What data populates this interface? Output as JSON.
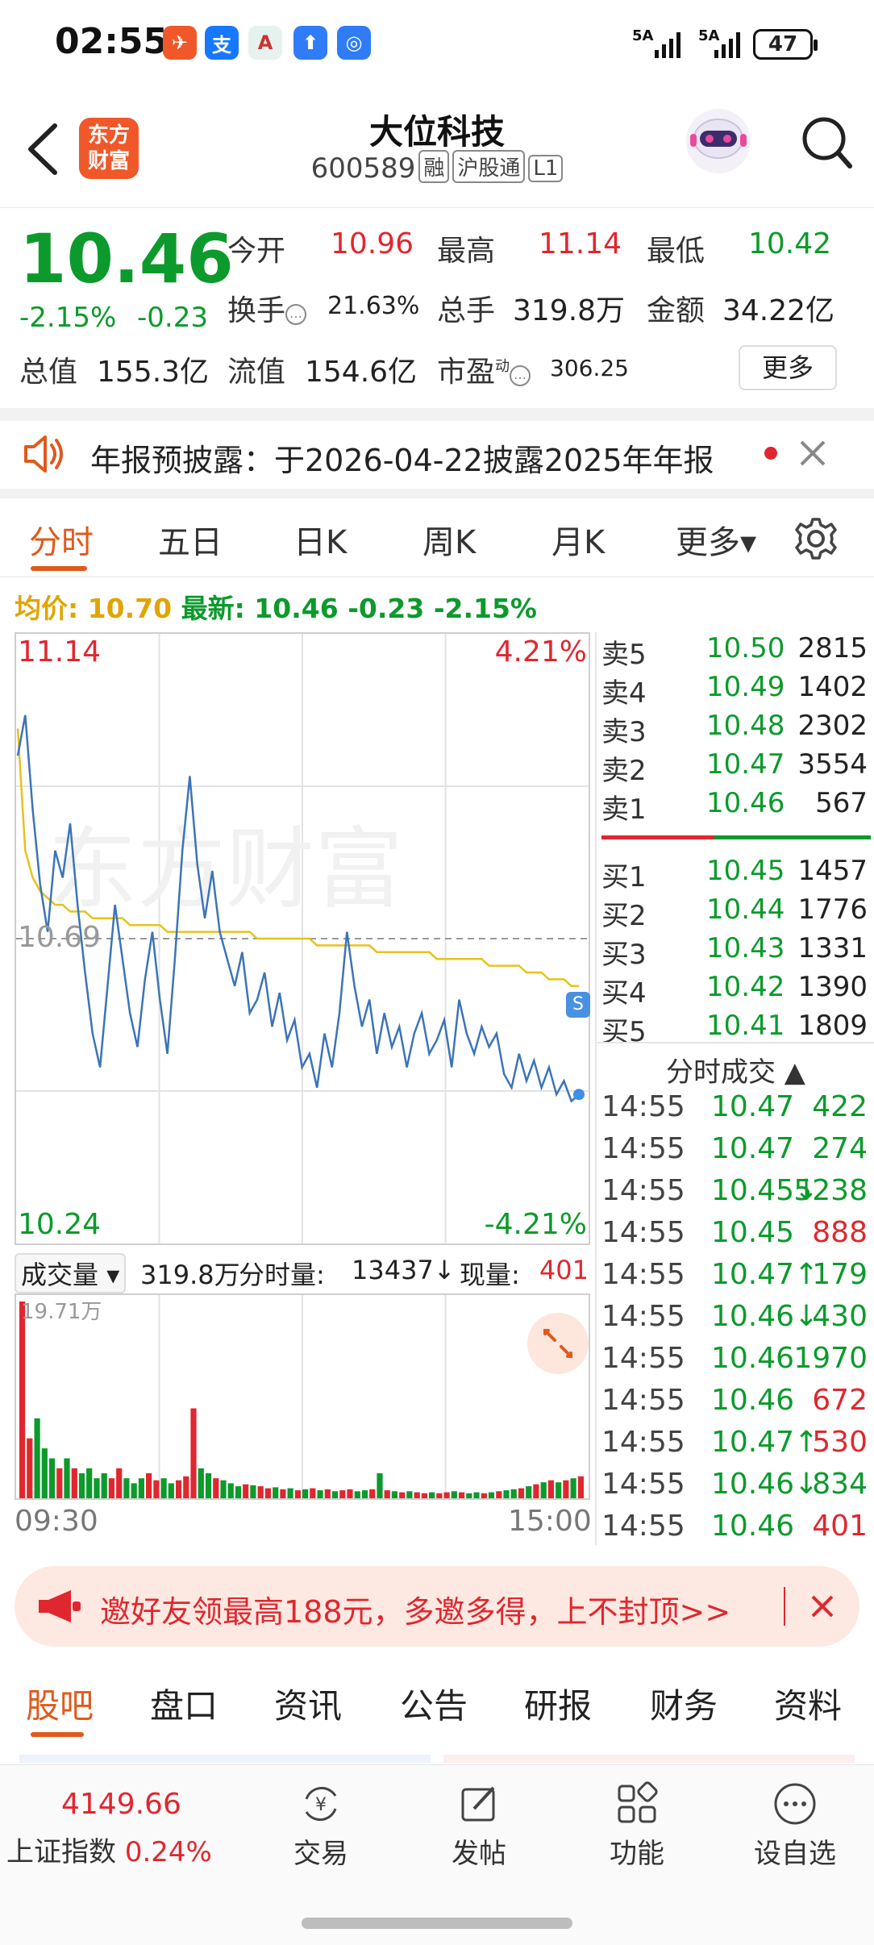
{
  "status": {
    "time": "02:55",
    "apps": [
      {
        "icon": "paper-plane-icon",
        "glyph": "✈",
        "color": "#f0582a"
      },
      {
        "icon": "alipay-icon",
        "glyph": "支",
        "color": "#1677ff"
      },
      {
        "icon": "bank-icon",
        "glyph": "A",
        "color": "#e6f2ee"
      },
      {
        "icon": "upload-icon",
        "glyph": "⬆",
        "color": "#2f7cf6"
      },
      {
        "icon": "chart-app-icon",
        "glyph": "◎",
        "color": "#2f7cf6"
      }
    ],
    "signal1": "5A",
    "signal2": "5A",
    "battery": "47"
  },
  "header": {
    "logo_line1": "东方",
    "logo_line2": "财富",
    "stock_name": "大位科技",
    "stock_code": "600589",
    "tag_margin": "融",
    "tag_connect": "沪股通",
    "tag_level": "L1"
  },
  "quote": {
    "price": "10.46",
    "change_pct": "-2.15%",
    "change_amt": "-0.23",
    "open_label": "今开",
    "open": "10.96",
    "high_label": "最高",
    "high": "11.14",
    "low_label": "最低",
    "low": "10.42",
    "turnover_label": "换手",
    "turnover": "21.63%",
    "volume_label": "总手",
    "volume": "319.8万",
    "amount_label": "金额",
    "amount": "34.22亿",
    "mcap_label": "总值",
    "mcap": "155.3亿",
    "float_label": "流值",
    "float": "154.6亿",
    "pe_label": "市盈",
    "pe_sup": "动",
    "pe": "306.25",
    "more": "更多"
  },
  "notice": {
    "text": "年报预披露：于2026-04-22披露2025年年报"
  },
  "chart_tabs": [
    "分时",
    "五日",
    "日K",
    "周K",
    "月K",
    "更多▾"
  ],
  "avg_line": {
    "avg_label": "均价:",
    "avg": "10.70",
    "latest_label": "最新:",
    "latest": "10.46",
    "chg": "-0.23",
    "pct": "-2.15%"
  },
  "chart_data": {
    "type": "line",
    "title": "",
    "ylim": [
      10.24,
      11.14
    ],
    "top_label": "11.14",
    "top_pct": "4.21%",
    "bottom_label": "10.24",
    "bottom_pct": "-4.21%",
    "mid_label": "10.69",
    "x_start": "09:30",
    "x_end": "15:00",
    "series": [
      {
        "values": [
          10.96,
          11.02,
          10.88,
          10.77,
          10.7,
          10.82,
          10.78,
          10.86,
          10.74,
          10.64,
          10.55,
          10.5,
          10.62,
          10.74,
          10.66,
          10.58,
          10.53,
          10.63,
          10.7,
          10.6,
          10.52,
          10.66,
          10.82,
          10.93,
          10.8,
          10.72,
          10.79,
          10.7,
          10.66,
          10.62,
          10.67,
          10.58,
          10.6,
          10.64,
          10.56,
          10.61,
          10.54,
          10.57,
          10.5,
          10.52,
          10.47,
          10.55,
          10.5,
          10.58,
          10.7,
          10.62,
          10.56,
          10.6,
          10.52,
          10.58,
          10.53,
          10.56,
          10.5,
          10.55,
          10.58,
          10.52,
          10.54,
          10.57,
          10.5,
          10.6,
          10.55,
          10.52,
          10.56,
          10.53,
          10.55,
          10.49,
          10.47,
          10.52,
          10.48,
          10.51,
          10.47,
          10.5,
          10.46,
          10.48,
          10.45,
          10.46
        ]
      },
      {
        "values": [
          11.0,
          10.82,
          10.78,
          10.76,
          10.75,
          10.74,
          10.74,
          10.73,
          10.73,
          10.73,
          10.72,
          10.72,
          10.72,
          10.72,
          10.72,
          10.71,
          10.71,
          10.71,
          10.71,
          10.71,
          10.7,
          10.7,
          10.7,
          10.7,
          10.7,
          10.7,
          10.7,
          10.7,
          10.7,
          10.7,
          10.7,
          10.7,
          10.69,
          10.69,
          10.69,
          10.69,
          10.69,
          10.69,
          10.69,
          10.69,
          10.68,
          10.68,
          10.68,
          10.68,
          10.68,
          10.68,
          10.68,
          10.68,
          10.67,
          10.67,
          10.67,
          10.67,
          10.67,
          10.67,
          10.67,
          10.67,
          10.66,
          10.66,
          10.66,
          10.66,
          10.66,
          10.66,
          10.66,
          10.65,
          10.65,
          10.65,
          10.65,
          10.65,
          10.64,
          10.64,
          10.64,
          10.63,
          10.63,
          10.63,
          10.62,
          10.62
        ]
      }
    ],
    "volume": {
      "label": "成交量",
      "total": "319.8万",
      "minute_label": "分时量:",
      "minute": "13437↓",
      "now_label": "现量:",
      "now": "401",
      "max_label": "19.71万",
      "values": [
        19.7,
        6,
        8,
        5,
        4,
        3,
        4,
        3,
        2.5,
        3,
        2,
        2.5,
        2,
        3,
        2,
        1.5,
        2,
        2.5,
        1.8,
        2,
        1.5,
        1.8,
        2.2,
        9,
        3,
        2.5,
        2,
        1.8,
        1.5,
        1.2,
        1.4,
        1.3,
        1.2,
        1,
        1.1,
        0.9,
        1,
        0.8,
        0.9,
        1,
        0.8,
        0.9,
        0.7,
        0.8,
        0.9,
        0.7,
        0.8,
        0.9,
        2.5,
        0.8,
        0.7,
        0.6,
        0.7,
        0.6,
        0.5,
        0.6,
        0.5,
        0.6,
        0.7,
        0.6,
        0.5,
        0.6,
        0.5,
        0.6,
        0.7,
        0.8,
        0.9,
        1,
        1.2,
        1.4,
        1.6,
        1.8,
        1.6,
        1.8,
        2.0,
        2.2
      ]
    }
  },
  "order_book": {
    "asks": [
      {
        "label": "卖5",
        "price": "10.50",
        "vol": "2815"
      },
      {
        "label": "卖4",
        "price": "10.49",
        "vol": "1402"
      },
      {
        "label": "卖3",
        "price": "10.48",
        "vol": "2302"
      },
      {
        "label": "卖2",
        "price": "10.47",
        "vol": "3554"
      },
      {
        "label": "卖1",
        "price": "10.46",
        "vol": "567"
      }
    ],
    "bids": [
      {
        "label": "买1",
        "price": "10.45",
        "vol": "1457"
      },
      {
        "label": "买2",
        "price": "10.44",
        "vol": "1776"
      },
      {
        "label": "买3",
        "price": "10.43",
        "vol": "1331"
      },
      {
        "label": "买4",
        "price": "10.42",
        "vol": "1390"
      },
      {
        "label": "买5",
        "price": "10.41",
        "vol": "1809"
      }
    ]
  },
  "trades": {
    "title": "分时成交 ▲",
    "rows": [
      {
        "time": "14:55",
        "price": "10.47",
        "vol": "422",
        "vcolor": "#0c9a2c"
      },
      {
        "time": "14:55",
        "price": "10.47",
        "vol": "274",
        "vcolor": "#0c9a2c"
      },
      {
        "time": "14:55",
        "price": "10.45↓",
        "vol": "5238",
        "vcolor": "#0c9a2c"
      },
      {
        "time": "14:55",
        "price": "10.45",
        "vol": "888",
        "vcolor": "#e0272f"
      },
      {
        "time": "14:55",
        "price": "10.47↑",
        "vol": "179",
        "vcolor": "#0c9a2c"
      },
      {
        "time": "14:55",
        "price": "10.46↓",
        "vol": "430",
        "vcolor": "#0c9a2c"
      },
      {
        "time": "14:55",
        "price": "10.46",
        "vol": "1970",
        "vcolor": "#0c9a2c"
      },
      {
        "time": "14:55",
        "price": "10.46",
        "vol": "672",
        "vcolor": "#e0272f"
      },
      {
        "time": "14:55",
        "price": "10.47↑",
        "vol": "530",
        "vcolor": "#e0272f"
      },
      {
        "time": "14:55",
        "price": "10.46↓",
        "vol": "834",
        "vcolor": "#0c9a2c"
      },
      {
        "time": "14:55",
        "price": "10.46",
        "vol": "401",
        "vcolor": "#e0272f"
      }
    ]
  },
  "promo": {
    "text": "邀好友领最高188元，多邀多得，上不封顶>>"
  },
  "bottom_tabs": [
    "股吧",
    "盘口",
    "资讯",
    "公告",
    "研报",
    "财务",
    "资料"
  ],
  "bottom_nav": {
    "index_value": "4149.66",
    "index_name": "上证指数",
    "index_pct": "0.24%",
    "items": [
      "交易",
      "发帖",
      "功能",
      "设自选"
    ]
  }
}
